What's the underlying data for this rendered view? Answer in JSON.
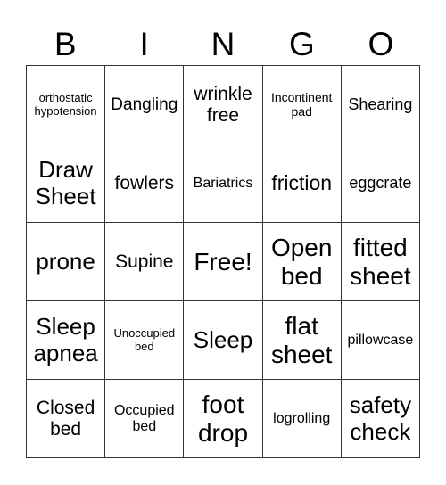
{
  "header": [
    "B",
    "I",
    "N",
    "G",
    "O"
  ],
  "cells": [
    [
      "orthostatic hypotension",
      "Dangling",
      "wrinkle free",
      "Incontinent pad",
      "Shearing"
    ],
    [
      "Draw Sheet",
      "fowlers",
      "Bariatrics",
      "friction",
      "eggcrate"
    ],
    [
      "prone",
      "Supine",
      "Free!",
      "Open bed",
      "fitted sheet"
    ],
    [
      "Sleep apnea",
      "Unoccupied bed",
      "Sleep",
      "flat sheet",
      "pillowcase"
    ],
    [
      "Closed bed",
      "Occupied bed",
      "foot drop",
      "logrolling",
      "safety check"
    ]
  ]
}
